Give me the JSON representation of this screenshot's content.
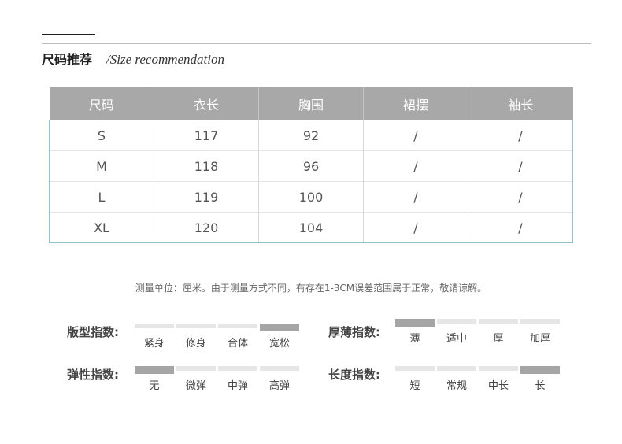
{
  "heading": {
    "cn": "尺码推荐",
    "en": "/Size recommendation"
  },
  "table": {
    "headers": [
      "尺码",
      "衣长",
      "胸围",
      "裙摆",
      "袖长"
    ],
    "rows": [
      [
        "S",
        "117",
        "92",
        "/",
        "/"
      ],
      [
        "M",
        "118",
        "96",
        "/",
        "/"
      ],
      [
        "L",
        "119",
        "100",
        "/",
        "/"
      ],
      [
        "XL",
        "120",
        "104",
        "/",
        "/"
      ]
    ]
  },
  "note": "测量单位：厘米。由于测量方式不同，有存在1-3CM误差范围属于正常，敬请谅解。",
  "indices": {
    "fit": {
      "label": "版型指数:",
      "options": [
        "紧身",
        "修身",
        "合体",
        "宽松"
      ],
      "selected": 3
    },
    "thickness": {
      "label": "厚薄指数:",
      "options": [
        "薄",
        "适中",
        "厚",
        "加厚"
      ],
      "selected": 0
    },
    "elasticity": {
      "label": "弹性指数:",
      "options": [
        "无",
        "微弹",
        "中弹",
        "高弹"
      ],
      "selected": 0
    },
    "length": {
      "label": "长度指数:",
      "options": [
        "短",
        "常规",
        "中长",
        "长"
      ],
      "selected": 3
    }
  },
  "colors": {
    "header_bg": "#a8a8a8",
    "table_border": "#8fc3cc",
    "scale_active": "#a5a5a5",
    "scale_inactive": "#e6e6e6"
  }
}
